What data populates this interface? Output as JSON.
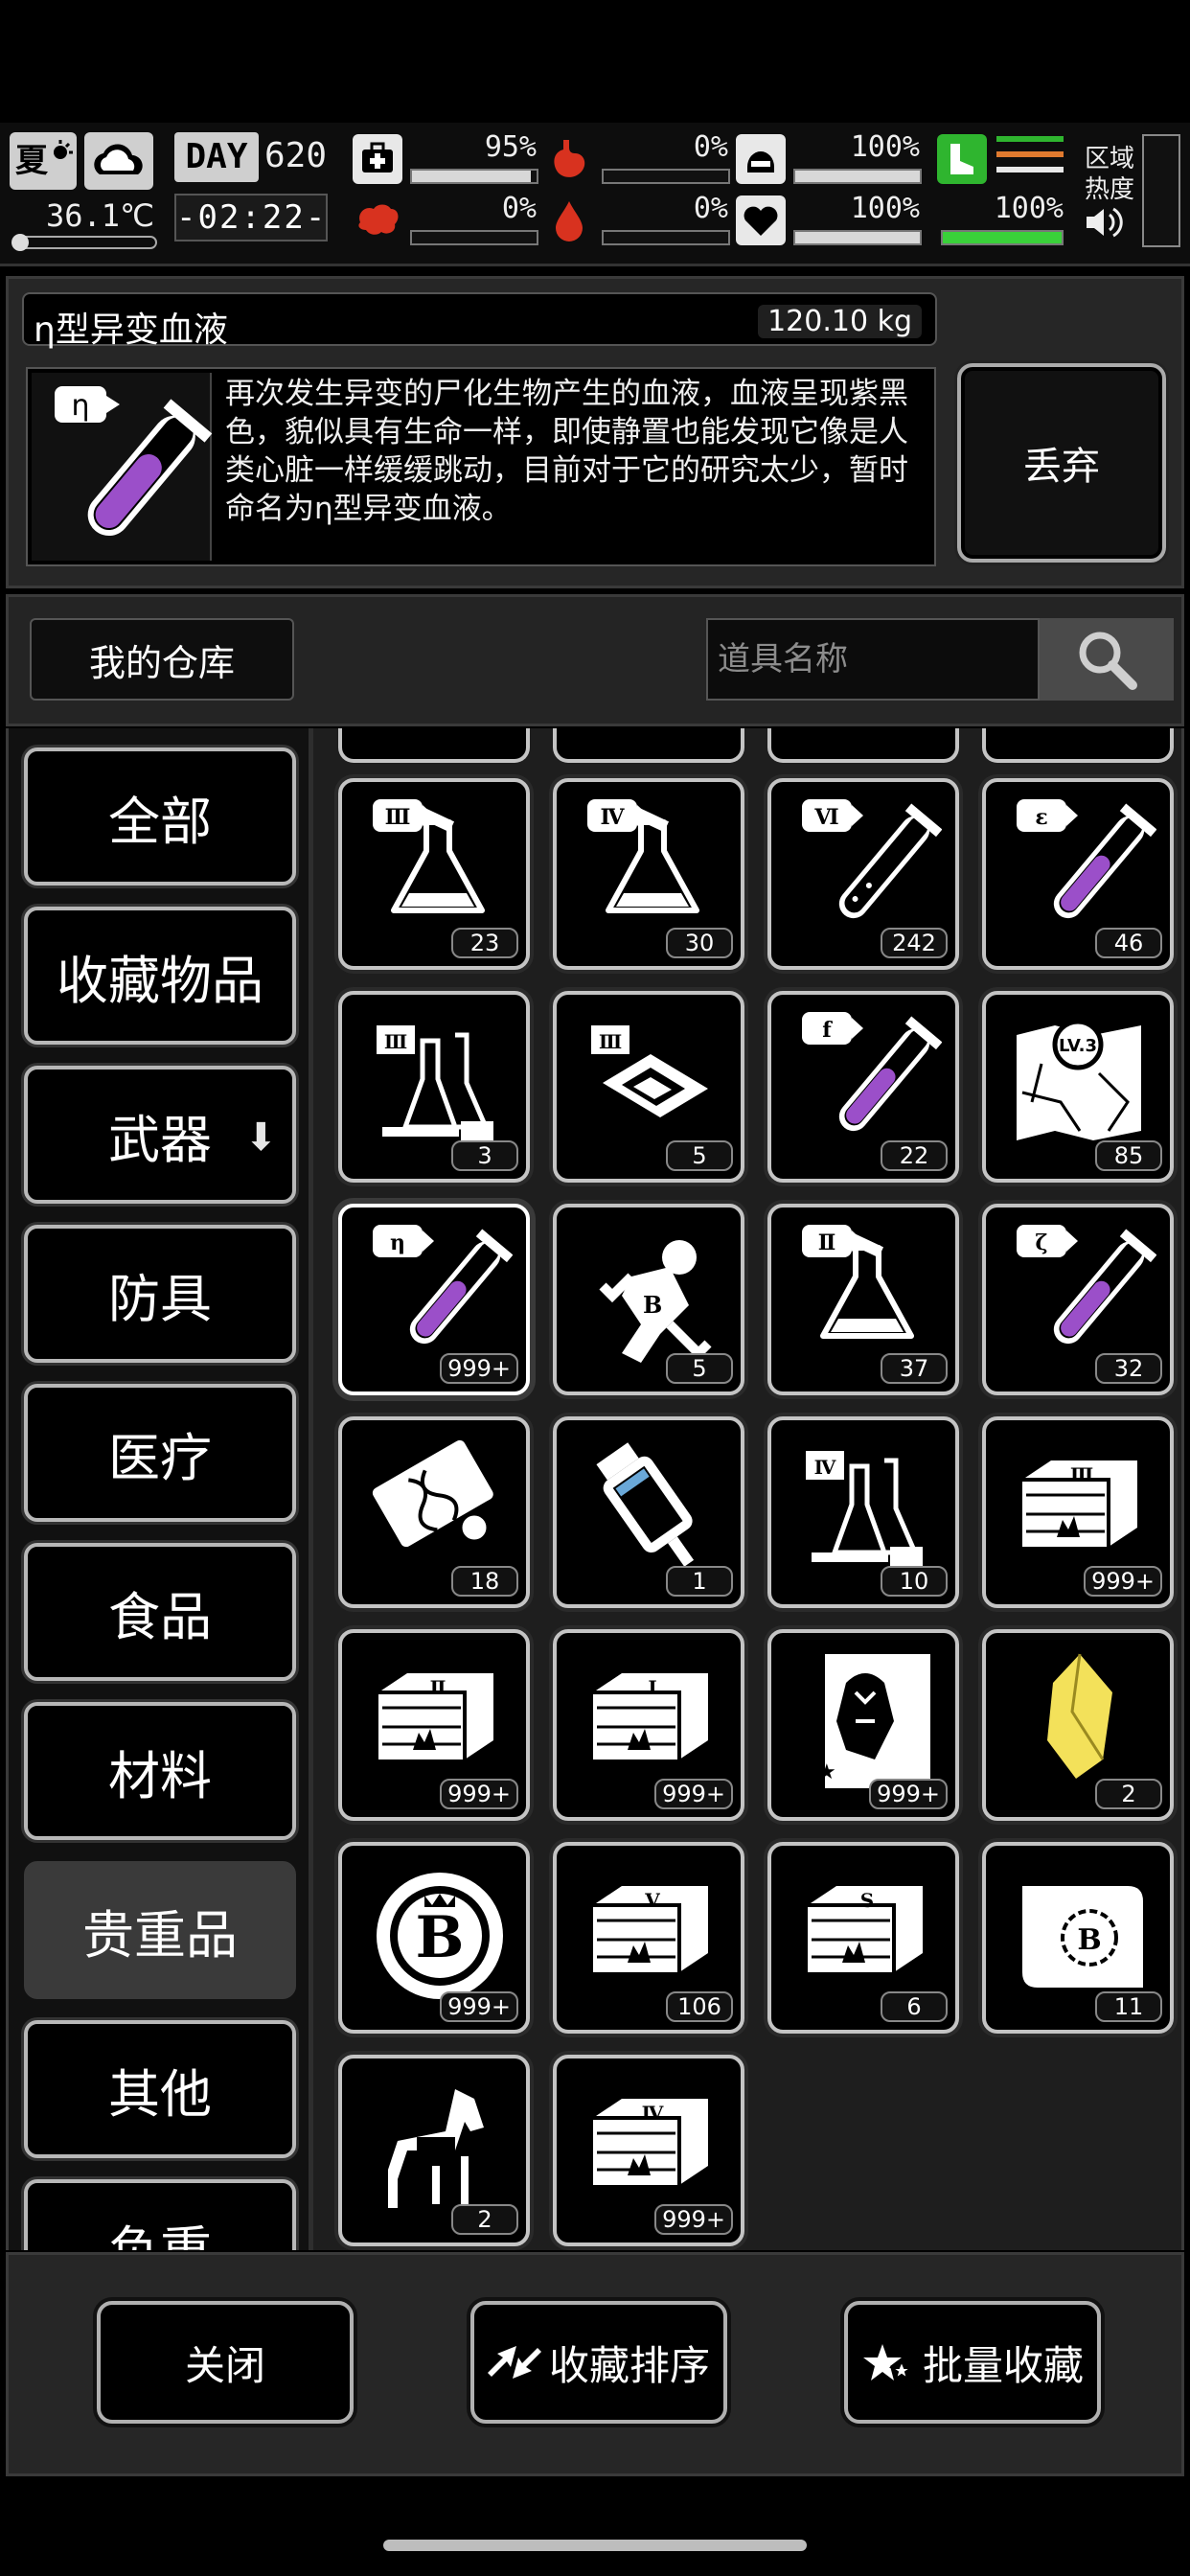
{
  "status": {
    "season": "夏",
    "temperature": "36.1℃",
    "day_label": "DAY",
    "day_number": "620",
    "clock": "-02:22-",
    "stats": {
      "health": "95%",
      "stomach": "0%",
      "water_status": "100%",
      "stamina": "100%",
      "brain": "0%",
      "blood": "0%",
      "heart": "100%"
    },
    "zone_heat_label": "区域热度"
  },
  "item": {
    "name": "η型异变血液",
    "weight": "120.10 kg",
    "description": "再次发生异变的尸化生物产生的血液，血液呈现紫黑色，貌似具有生命一样，即使静置也能发现它像是人类心脏一样缓缓跳动，目前对于它的研究太少，暂时命名为η型异变血液。",
    "discard_label": "丢弃"
  },
  "warehouse": {
    "title": "我的仓库",
    "search_placeholder": "道具名称"
  },
  "categories": [
    {
      "label": "全部"
    },
    {
      "label": "收藏物品"
    },
    {
      "label": "武器"
    },
    {
      "label": "防具"
    },
    {
      "label": "医疗"
    },
    {
      "label": "食品"
    },
    {
      "label": "材料"
    },
    {
      "label": "贵重品"
    },
    {
      "label": "其他"
    },
    {
      "label": "负重"
    }
  ],
  "active_category": "贵重品",
  "items": [
    {
      "icon": "flask-iii-icon",
      "count": "23"
    },
    {
      "icon": "flask-iv-icon",
      "count": "30"
    },
    {
      "icon": "test-tube-vi-icon",
      "count": "242"
    },
    {
      "icon": "test-tube-epsilon-icon",
      "count": "46"
    },
    {
      "icon": "lab-equipment-iii-icon",
      "count": "3"
    },
    {
      "icon": "chip-iii-icon",
      "count": "5"
    },
    {
      "icon": "test-tube-f-icon",
      "count": "22"
    },
    {
      "icon": "map-lv3-icon",
      "count": "85"
    },
    {
      "icon": "test-tube-eta-icon",
      "count": "999+"
    },
    {
      "icon": "astronaut-icon",
      "count": "5"
    },
    {
      "icon": "flask-ii-icon",
      "count": "37"
    },
    {
      "icon": "test-tube-zeta-icon",
      "count": "32"
    },
    {
      "icon": "dna-ticket-icon",
      "count": "18"
    },
    {
      "icon": "syringe-capsule-icon",
      "count": "1"
    },
    {
      "icon": "lab-equipment-iv-icon",
      "count": "10"
    },
    {
      "icon": "crate-iii-icon",
      "count": "999+"
    },
    {
      "icon": "crate-ii-icon",
      "count": "999+"
    },
    {
      "icon": "crate-i-icon",
      "count": "999+"
    },
    {
      "icon": "zombie-poster-icon",
      "count": "999+"
    },
    {
      "icon": "gold-crystal-icon",
      "count": "2"
    },
    {
      "icon": "b-coin-icon",
      "count": "999+"
    },
    {
      "icon": "crate-v-icon",
      "count": "106"
    },
    {
      "icon": "crate-s-icon",
      "count": "6"
    },
    {
      "icon": "scroll-b-icon",
      "count": "11"
    },
    {
      "icon": "horse-icon",
      "count": "2"
    },
    {
      "icon": "crate-iv-icon",
      "count": "999+"
    }
  ],
  "bottom": {
    "close_label": "关闭",
    "sort_label": "收藏排序",
    "batch_label": "批量收藏"
  }
}
